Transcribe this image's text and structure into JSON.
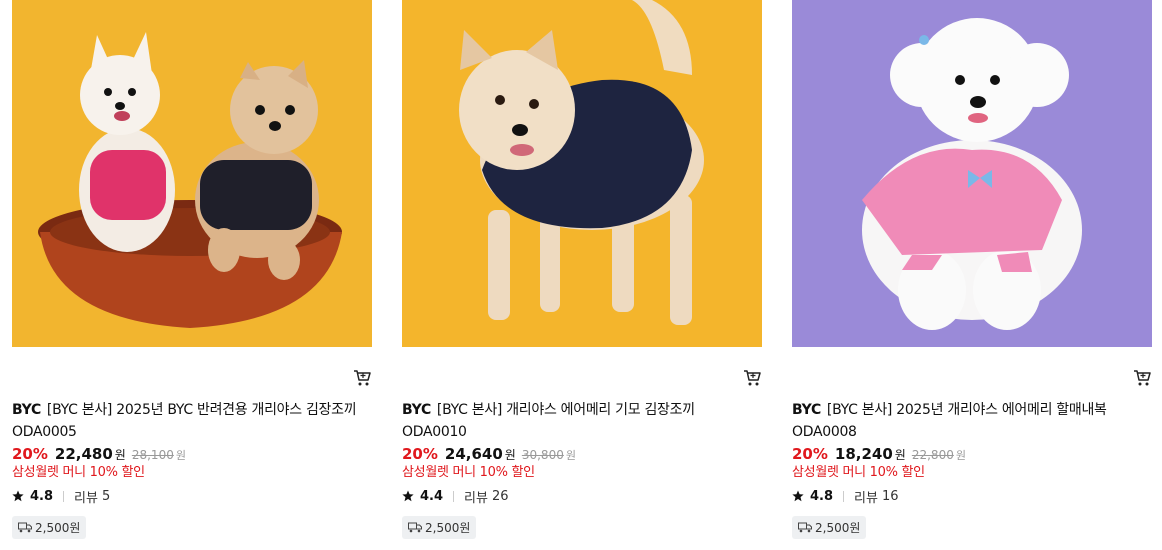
{
  "products": [
    {
      "brand": "BYC",
      "name": "[BYC 본사] 2025년 BYC 반려견용 개리야스 김장조끼 ODA0005",
      "discount": "20%",
      "price": "22,480",
      "currency": "원",
      "original_price": "28,100",
      "original_currency": "원",
      "benefit": "삼성월렛 머니 10% 할인",
      "rating": "4.8",
      "review_label": "리뷰",
      "review_count": "5",
      "shipping_fee": "2,500원",
      "bg_color": "#f2b52f"
    },
    {
      "brand": "BYC",
      "name": "[BYC 본사] 개리야스 에어메리 기모 김장조끼 ODA0010",
      "discount": "20%",
      "price": "24,640",
      "currency": "원",
      "original_price": "30,800",
      "original_currency": "원",
      "benefit": "삼성월렛 머니 10% 할인",
      "rating": "4.4",
      "review_label": "리뷰",
      "review_count": "26",
      "shipping_fee": "2,500원",
      "bg_color": "#f4b52c"
    },
    {
      "brand": "BYC",
      "name": "[BYC 본사] 2025년 개리야스 에어메리 할매내복 ODA0008",
      "discount": "20%",
      "price": "18,240",
      "currency": "원",
      "original_price": "22,800",
      "original_currency": "원",
      "benefit": "삼성월렛 머니 10% 할인",
      "rating": "4.8",
      "review_label": "리뷰",
      "review_count": "16",
      "shipping_fee": "2,500원",
      "bg_color": "#9a8ad8"
    }
  ],
  "colors": {
    "discount": "#e0181d",
    "benefit": "#e0181d",
    "strike": "#999999",
    "shipping_bg": "#eef0f2"
  },
  "icons": {
    "cart": "cart-icon",
    "star": "star-icon",
    "shipping": "truck-icon"
  }
}
